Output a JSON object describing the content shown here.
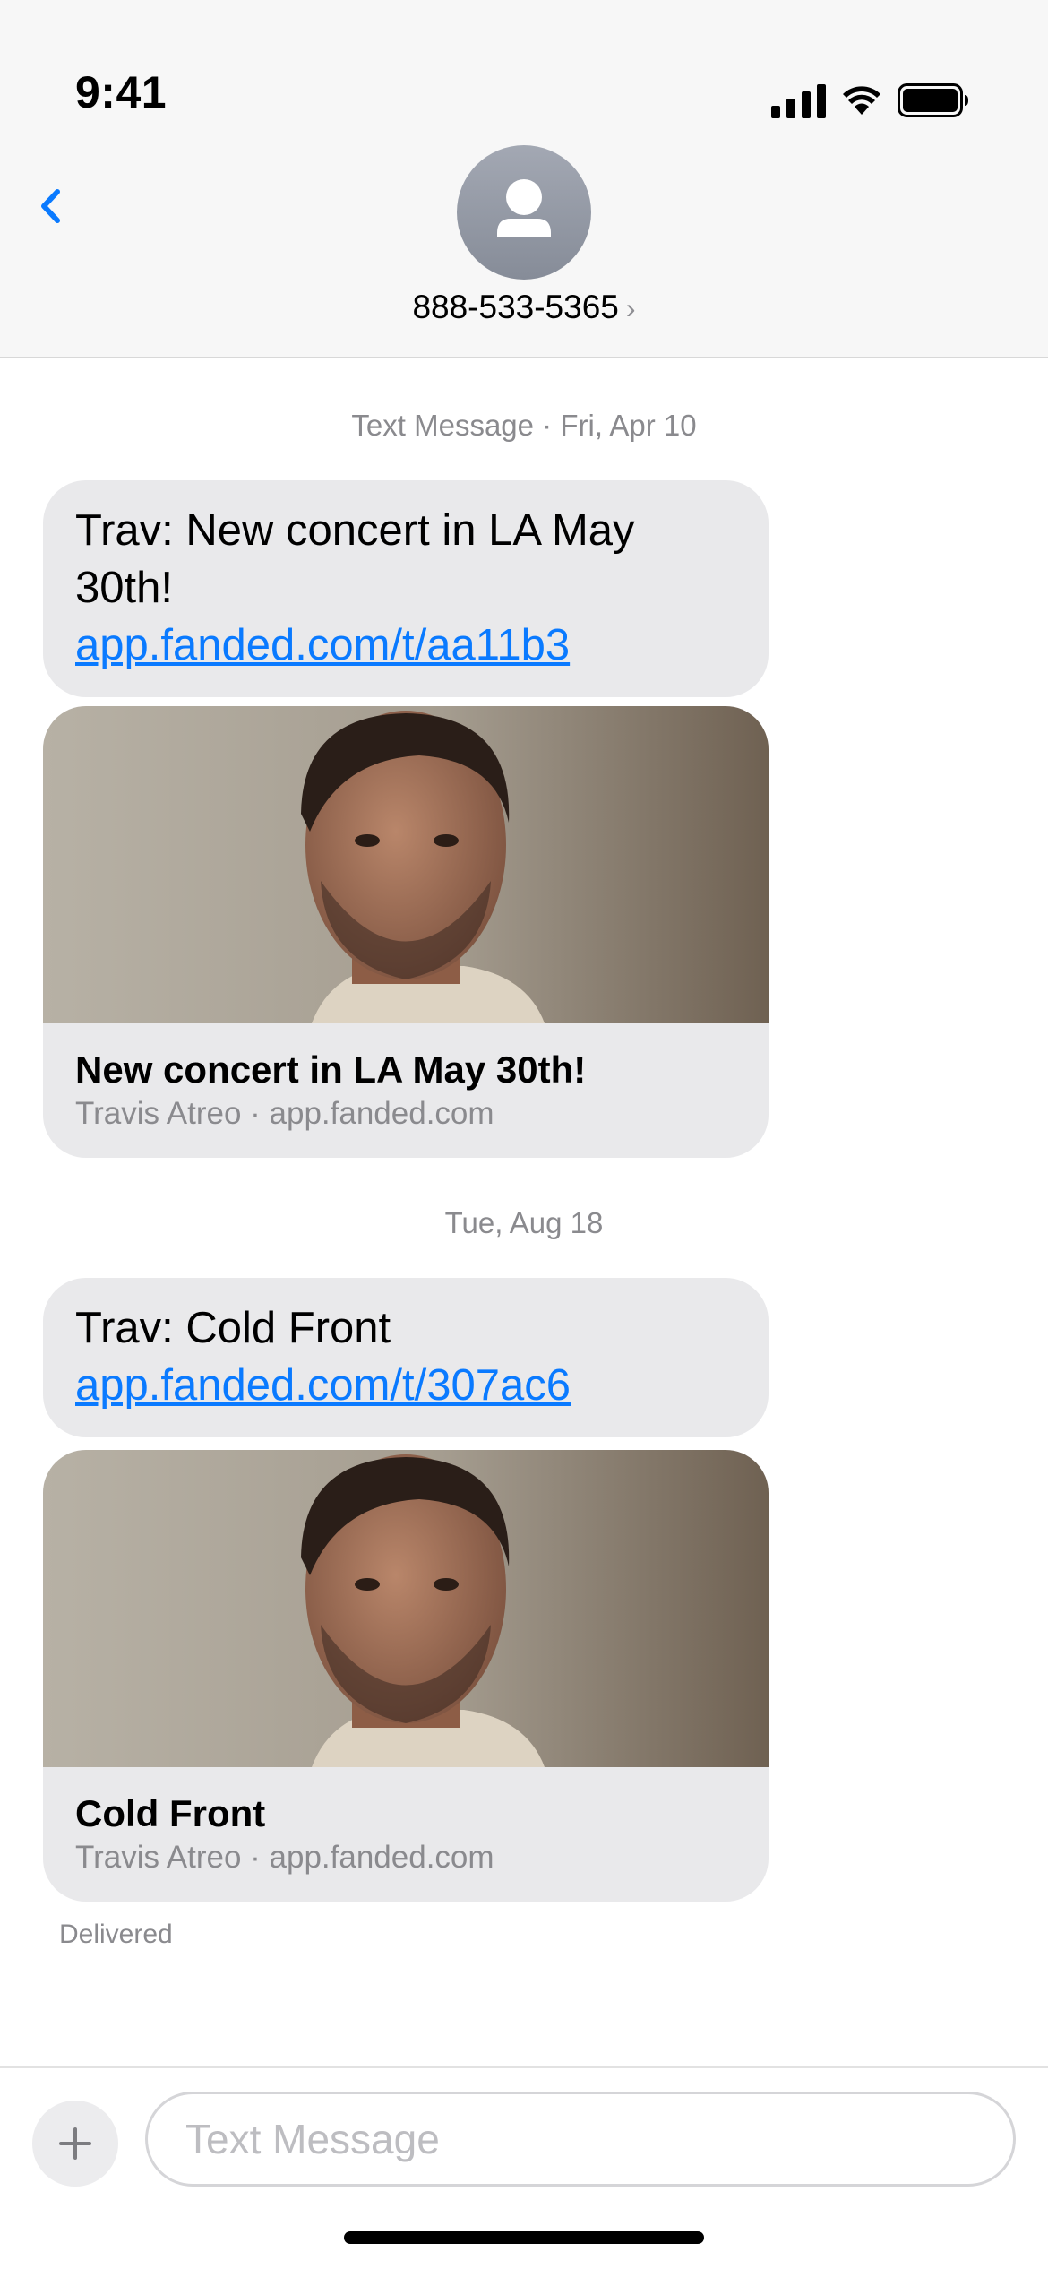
{
  "status_bar": {
    "time": "9:41",
    "icons": [
      "signal-icon",
      "wifi-icon",
      "battery-icon"
    ]
  },
  "header": {
    "back_icon": "chevron-left-icon",
    "avatar_icon": "person-icon",
    "contact": "888-533-5365",
    "contact_chevron": "›"
  },
  "thread": {
    "groups": [
      {
        "timestamp": "Text Message · Fri, Apr 10",
        "text": "Trav: New concert in LA May 30th!",
        "link": "app.fanded.com/t/aa11b3",
        "preview_title": "New concert in LA May 30th!",
        "preview_meta": "Travis Atreo · app.fanded.com"
      },
      {
        "timestamp": "Tue, Aug 18",
        "text": "Trav: Cold Front",
        "link": "app.fanded.com/t/307ac6",
        "preview_title": "Cold Front",
        "preview_meta": "Travis Atreo · app.fanded.com"
      }
    ],
    "status": "Delivered"
  },
  "composer": {
    "plus_icon": "plus-icon",
    "placeholder": "Text Message"
  },
  "colors": {
    "link": "#0a7aff",
    "bubble": "#e9e9eb",
    "secondary_text": "#8a8a8e"
  }
}
